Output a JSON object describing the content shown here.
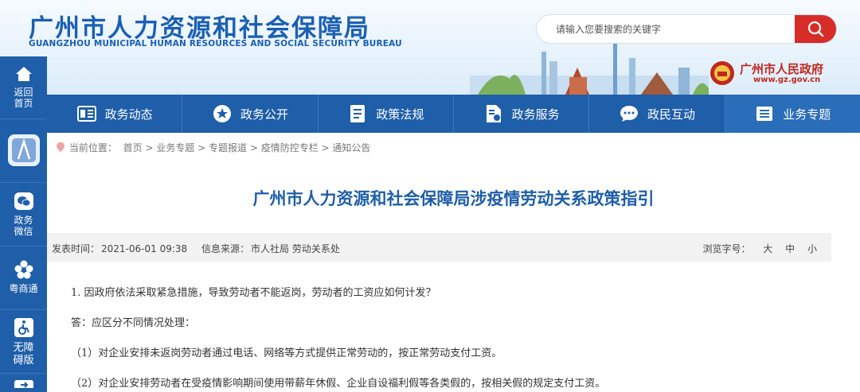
{
  "header": {
    "title": "广州市人力资源和社会保障局",
    "subtitle": "GUANGZHOU MUNICIPAL HUMAN RESOURCES AND SOCIAL SECURITY BUREAU",
    "search_placeholder": "请输入您要搜索的关键字",
    "gov_name": "广州市人民政府",
    "gov_url": "www.gz.gov.cn"
  },
  "nav": {
    "items": [
      {
        "label": "政务动态",
        "icon": "newspaper-icon"
      },
      {
        "label": "政务公开",
        "icon": "star-icon"
      },
      {
        "label": "政策法规",
        "icon": "document-icon"
      },
      {
        "label": "政务服务",
        "icon": "service-icon"
      },
      {
        "label": "政民互动",
        "icon": "chat-icon"
      },
      {
        "label": "业务专题",
        "icon": "menu-icon"
      }
    ]
  },
  "sidebar": {
    "items": [
      {
        "label": "返回首页",
        "icon": "home-icon"
      },
      {
        "label": "",
        "icon": "app-icon"
      },
      {
        "label": "政务微信",
        "icon": "wechat-icon"
      },
      {
        "label": "粤商通",
        "icon": "flower-icon"
      },
      {
        "label": "无障碍版",
        "icon": "wheelchair-icon"
      }
    ]
  },
  "breadcrumb": {
    "prefix": "当前位置：",
    "path": "首页 > 业务专题 > 专题报道 > 疫情防控专栏 > 通知公告"
  },
  "article": {
    "title": "广州市人力资源和社会保障局涉疫情劳动关系政策指引",
    "publish_label": "发表时间：",
    "publish_time": "2021-06-01 09:38",
    "source_label": "信息来源：",
    "source": "市人社局 劳动关系处",
    "font_label": "浏览字号：",
    "font_sizes": [
      "大",
      "中",
      "小"
    ],
    "paragraphs": [
      "1. 因政府依法采取紧急措施，导致劳动者不能返岗，劳动者的工资应如何计发？",
      "答：应区分不同情况处理：",
      "（1）对企业安排未返岗劳动者通过电话、网络等方式提供正常劳动的，按正常劳动支付工资。",
      "（2）对企业安排劳动者在受疫情影响期间使用带薪年休假、企业自设福利假等各类假的，按相关假的规定支付工资。"
    ]
  },
  "colors": {
    "brand_blue": "#1f5ea8",
    "search_red": "#d72c28",
    "gov_red": "#c0281f"
  }
}
